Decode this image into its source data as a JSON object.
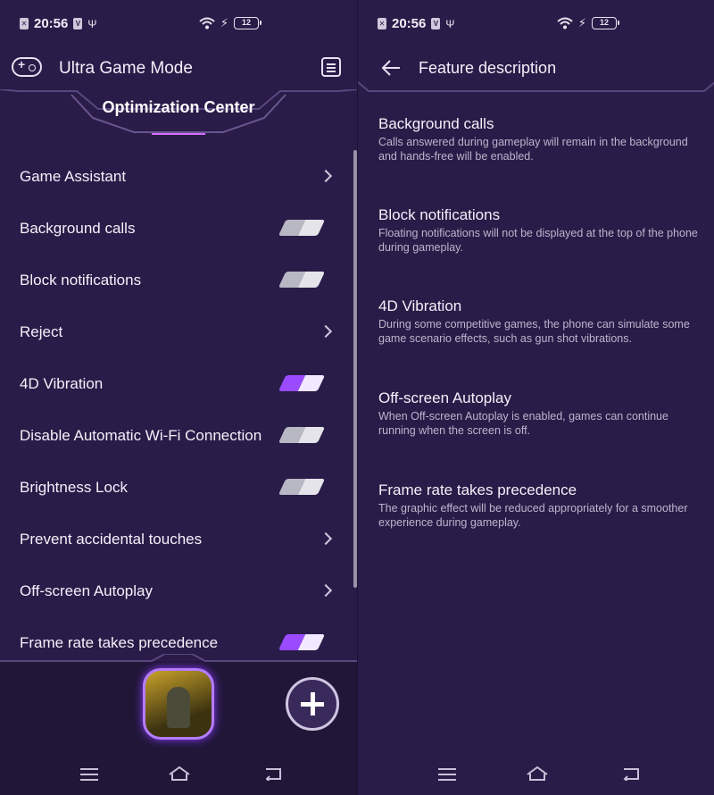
{
  "status_bar": {
    "time": "20:56",
    "battery": "12"
  },
  "left": {
    "header": {
      "title": "Ultra Game Mode"
    },
    "section_title": "Optimization Center",
    "items": [
      {
        "label": "Game Assistant",
        "control": "chevron"
      },
      {
        "label": "Background calls",
        "control": "toggle",
        "state": "off"
      },
      {
        "label": "Block notifications",
        "control": "toggle",
        "state": "off"
      },
      {
        "label": "Reject",
        "control": "chevron"
      },
      {
        "label": "4D Vibration",
        "control": "toggle",
        "state": "on"
      },
      {
        "label": "Disable Automatic Wi-Fi Connection",
        "control": "toggle",
        "state": "off"
      },
      {
        "label": "Brightness Lock",
        "control": "toggle",
        "state": "off"
      },
      {
        "label": "Prevent accidental touches",
        "control": "chevron"
      },
      {
        "label": "Off-screen Autoplay",
        "control": "chevron"
      },
      {
        "label": "Frame rate takes precedence",
        "control": "toggle",
        "state": "on"
      }
    ]
  },
  "right": {
    "header": {
      "title": "Feature description"
    },
    "descriptions": [
      {
        "title": "Background calls",
        "text": "Calls answered during gameplay will remain in the background and hands-free will be enabled."
      },
      {
        "title": "Block notifications",
        "text": "Floating notifications will not be displayed at the top of the phone during gameplay."
      },
      {
        "title": "4D Vibration",
        "text": "During some competitive games, the phone can simulate some game scenario effects, such as gun shot vibrations."
      },
      {
        "title": "Off-screen Autoplay",
        "text": "When Off-screen Autoplay is enabled, games can continue running when the screen is off."
      },
      {
        "title": "Frame rate takes precedence",
        "text": "The graphic effect will be reduced appropriately for a smoother experience during gameplay."
      }
    ]
  },
  "icons": {
    "gamepad": "gamepad-icon",
    "notes": "notes-icon",
    "back": "back-arrow-icon",
    "add": "add-icon",
    "nav_menu": "menu-icon",
    "nav_home": "home-icon",
    "nav_back": "back-icon"
  },
  "colors": {
    "background": "#2a1c48",
    "toggle_on": "#9a4bff",
    "toggle_off": "#b8b8c4"
  }
}
